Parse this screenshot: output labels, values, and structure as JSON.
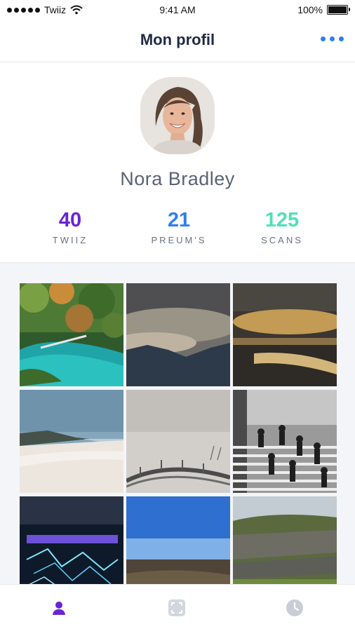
{
  "status_bar": {
    "carrier": "Twiiz",
    "time": "9:41 AM",
    "battery": "100%"
  },
  "header": {
    "title": "Mon profil"
  },
  "profile": {
    "name": "Nora Bradley"
  },
  "stats": [
    {
      "value": "40",
      "label": "TWIIZ",
      "color": "#6a24d1"
    },
    {
      "value": "21",
      "label": "PREUM'S",
      "color": "#2f7ef0"
    },
    {
      "value": "125",
      "label": "SCANS",
      "color": "#4fe0b8"
    }
  ],
  "gallery": {
    "photos": [
      "lake-forest",
      "cloudy-mountains",
      "beach-sunset",
      "sandy-beach",
      "bridge-sky",
      "stairs-crowd",
      "neon-lights",
      "blue-sky-landscape",
      "green-cliffs"
    ]
  },
  "tabs": [
    {
      "name": "profile",
      "icon": "person-icon",
      "active": true
    },
    {
      "name": "scan",
      "icon": "scan-icon",
      "active": false
    },
    {
      "name": "history",
      "icon": "clock-icon",
      "active": false
    }
  ],
  "colors": {
    "accent": "#6a24d1",
    "blue": "#2f7ef0",
    "teal": "#4fe0b8",
    "inactive_tab": "#c9cdd6"
  }
}
